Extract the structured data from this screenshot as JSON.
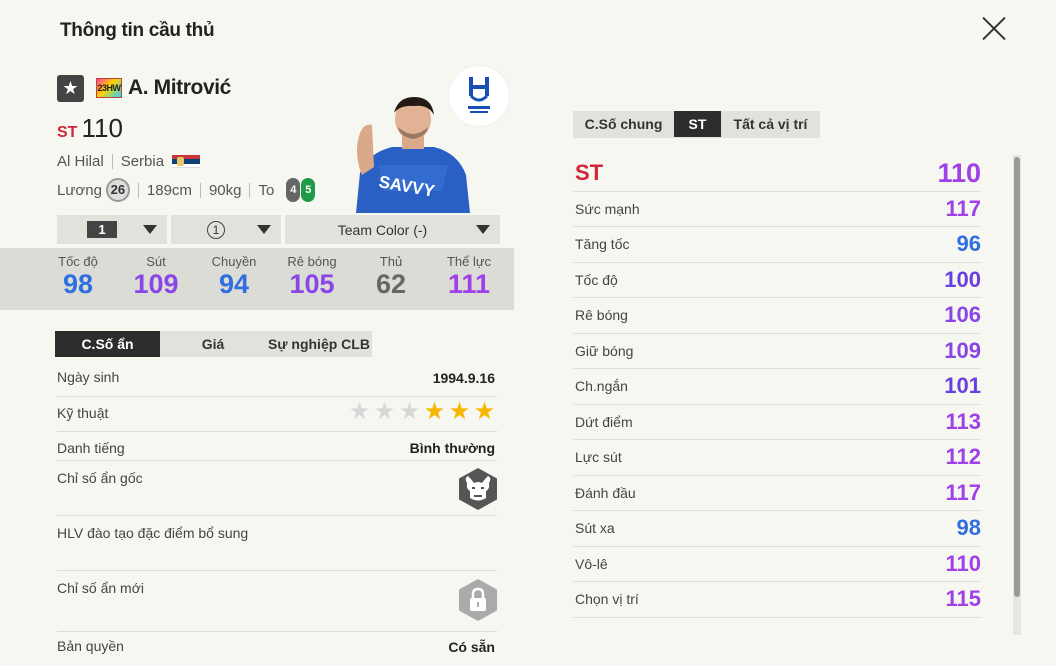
{
  "window": {
    "title": "Thông tin cầu thủ"
  },
  "player": {
    "name": "A. Mitrović",
    "season_badge": "23HW",
    "position": "ST",
    "ovr": "110",
    "club": "Al Hilal",
    "nation": "Serbia",
    "salary_label": "Lương",
    "salary": "26",
    "height": "189cm",
    "weight": "90kg",
    "body_type": "To",
    "weak_foot_left": "4",
    "strong_foot_right": "5"
  },
  "selectors": {
    "level": "1",
    "enhance": "1",
    "team_color": "Team Color (-)"
  },
  "summary": [
    {
      "label": "Tốc độ",
      "value": "98",
      "color": "#2f6fe0"
    },
    {
      "label": "Sút",
      "value": "109",
      "color": "#8a45e6"
    },
    {
      "label": "Chuyền",
      "value": "94",
      "color": "#2f6fe0"
    },
    {
      "label": "Rê bóng",
      "value": "105",
      "color": "#8a45e6"
    },
    {
      "label": "Thủ",
      "value": "62",
      "color": "#666666"
    },
    {
      "label": "Thể lực",
      "value": "111",
      "color": "#a040e8"
    }
  ],
  "tabs_left": [
    {
      "label": "C.Số ẩn"
    },
    {
      "label": "Giá"
    },
    {
      "label": "Sự nghiệp CLB"
    }
  ],
  "details": {
    "birth_label": "Ngày sinh",
    "birth": "1994.9.16",
    "skill_label": "Kỹ thuật",
    "skill_stars": 3,
    "skill_max": 6,
    "reputation_label": "Danh tiếng",
    "reputation": "Bình thường",
    "hidden_label": "Chỉ số ẩn gốc",
    "coach_label": "HLV đào tạo đặc điểm bổ sung",
    "new_hidden_label": "Chỉ số ẩn mới",
    "license_label": "Bản quyền",
    "license": "Có sẵn"
  },
  "tabs_right": [
    {
      "label": "C.Số chung"
    },
    {
      "label": "ST"
    },
    {
      "label": "Tất cả vị trí"
    }
  ],
  "stats": [
    {
      "label": "ST",
      "value": "110",
      "color": "#a040e8"
    },
    {
      "label": "Sức mạnh",
      "value": "117",
      "color": "#a040e8"
    },
    {
      "label": "Tăng tốc",
      "value": "96",
      "color": "#2f6fe0"
    },
    {
      "label": "Tốc độ",
      "value": "100",
      "color": "#6a3fe0"
    },
    {
      "label": "Rê bóng",
      "value": "106",
      "color": "#8a45e6"
    },
    {
      "label": "Giữ bóng",
      "value": "109",
      "color": "#8a45e6"
    },
    {
      "label": "Ch.ngắn",
      "value": "101",
      "color": "#6a3fe0"
    },
    {
      "label": "Dứt điểm",
      "value": "113",
      "color": "#a040e8"
    },
    {
      "label": "Lực sút",
      "value": "112",
      "color": "#a040e8"
    },
    {
      "label": "Đánh đầu",
      "value": "117",
      "color": "#a040e8"
    },
    {
      "label": "Sút xa",
      "value": "98",
      "color": "#2f6fe0"
    },
    {
      "label": "Vô-lê",
      "value": "110",
      "color": "#a040e8"
    },
    {
      "label": "Chọn vị trí",
      "value": "115",
      "color": "#a040e8"
    }
  ]
}
